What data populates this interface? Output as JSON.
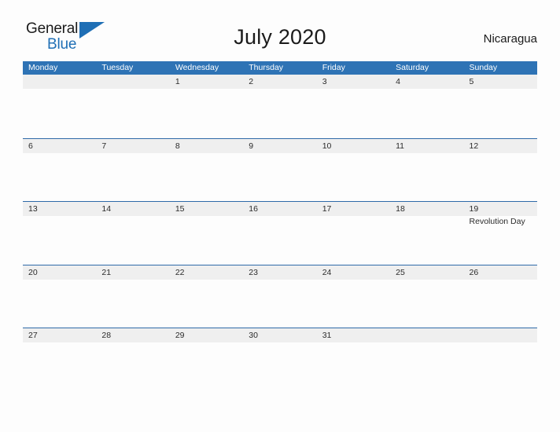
{
  "brand": {
    "name_line1": "General",
    "name_line2": "Blue",
    "triangle_icon": "triangle-icon",
    "color_dark": "#1b1b1b",
    "color_blue": "#1f6fb5"
  },
  "header": {
    "title": "July 2020",
    "region": "Nicaragua"
  },
  "colors": {
    "header_bar": "#2e73b5",
    "row_divider": "#2e6aa8",
    "date_band": "#efefef",
    "page_background": "#fdfdfd",
    "text": "#2b2b2b"
  },
  "calendar": {
    "month": "July",
    "year": "2020",
    "weekdays": [
      "Monday",
      "Tuesday",
      "Wednesday",
      "Thursday",
      "Friday",
      "Saturday",
      "Sunday"
    ],
    "weeks": [
      [
        {
          "day": "",
          "events": []
        },
        {
          "day": "",
          "events": []
        },
        {
          "day": "1",
          "events": []
        },
        {
          "day": "2",
          "events": []
        },
        {
          "day": "3",
          "events": []
        },
        {
          "day": "4",
          "events": []
        },
        {
          "day": "5",
          "events": []
        }
      ],
      [
        {
          "day": "6",
          "events": []
        },
        {
          "day": "7",
          "events": []
        },
        {
          "day": "8",
          "events": []
        },
        {
          "day": "9",
          "events": []
        },
        {
          "day": "10",
          "events": []
        },
        {
          "day": "11",
          "events": []
        },
        {
          "day": "12",
          "events": []
        }
      ],
      [
        {
          "day": "13",
          "events": []
        },
        {
          "day": "14",
          "events": []
        },
        {
          "day": "15",
          "events": []
        },
        {
          "day": "16",
          "events": []
        },
        {
          "day": "17",
          "events": []
        },
        {
          "day": "18",
          "events": []
        },
        {
          "day": "19",
          "events": [
            "Revolution Day"
          ]
        }
      ],
      [
        {
          "day": "20",
          "events": []
        },
        {
          "day": "21",
          "events": []
        },
        {
          "day": "22",
          "events": []
        },
        {
          "day": "23",
          "events": []
        },
        {
          "day": "24",
          "events": []
        },
        {
          "day": "25",
          "events": []
        },
        {
          "day": "26",
          "events": []
        }
      ],
      [
        {
          "day": "27",
          "events": []
        },
        {
          "day": "28",
          "events": []
        },
        {
          "day": "29",
          "events": []
        },
        {
          "day": "30",
          "events": []
        },
        {
          "day": "31",
          "events": []
        },
        {
          "day": "",
          "events": []
        },
        {
          "day": "",
          "events": []
        }
      ]
    ]
  }
}
